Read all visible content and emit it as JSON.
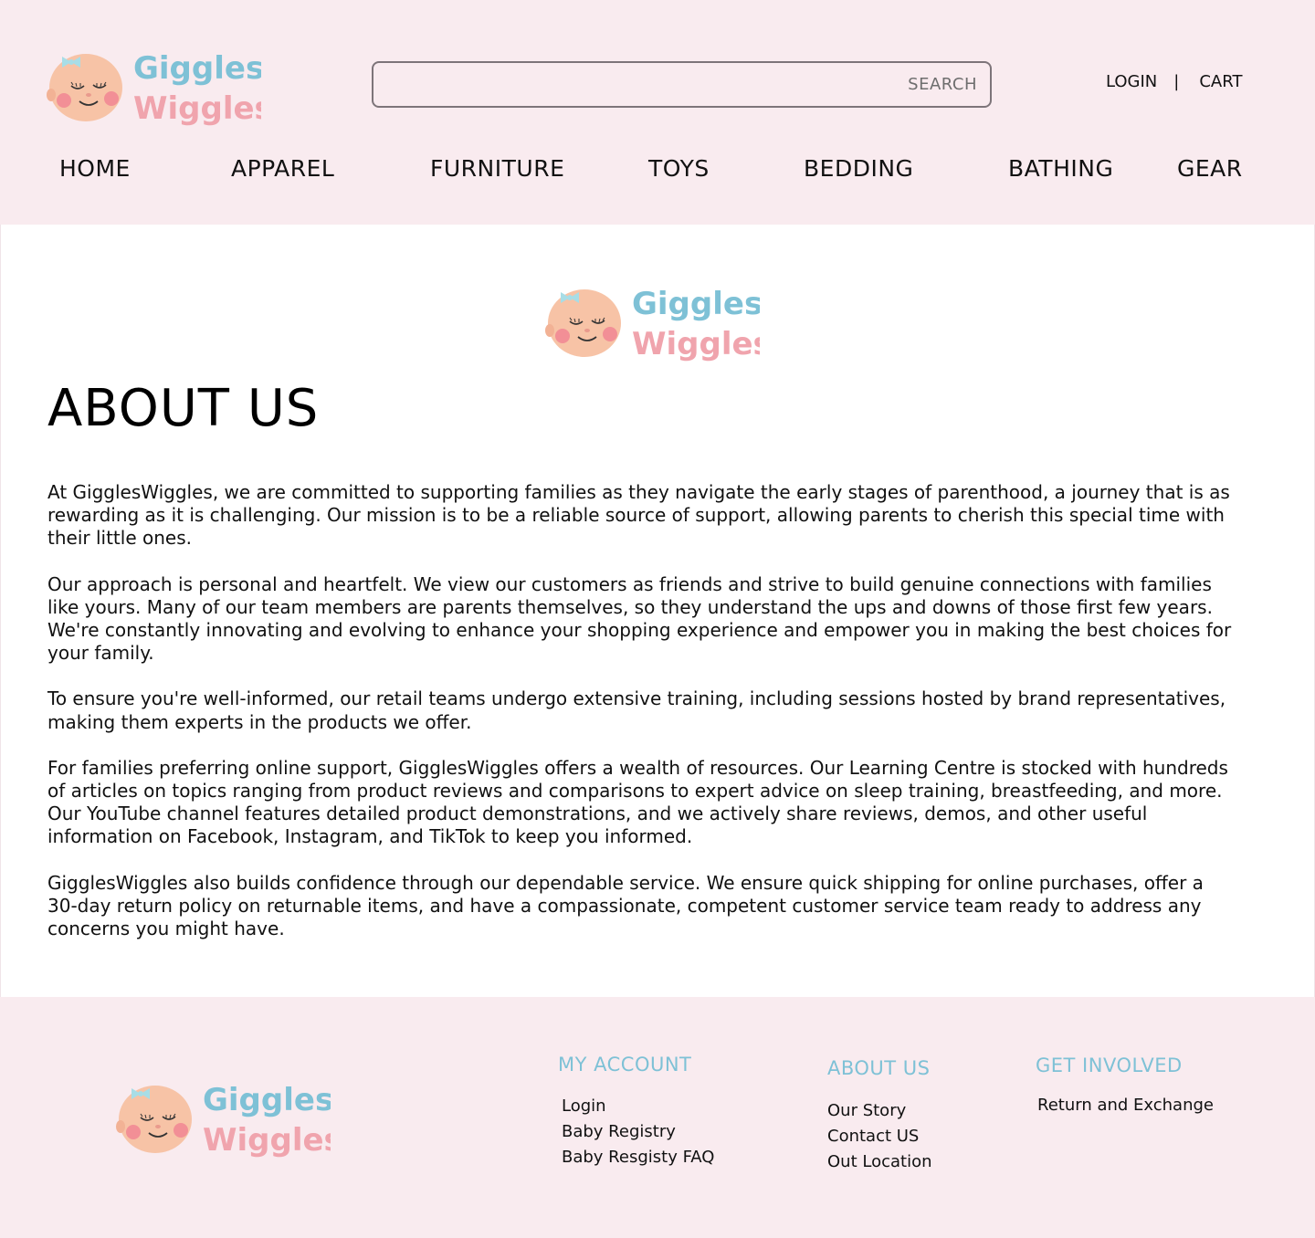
{
  "brand": {
    "logo_line1": "Giggles",
    "logo_line2": "Wiggles",
    "colors": {
      "header_bg": "#f9ebef",
      "logo_blue": "#7ec1d6",
      "logo_pink": "#f0a4ad",
      "face": "#f7c3a6",
      "cheek": "#f28f96",
      "bow": "#a8dde6"
    }
  },
  "search": {
    "placeholder": "",
    "button_label": "SEARCH"
  },
  "account": {
    "login": "LOGIN",
    "separator": "|",
    "cart": "CART"
  },
  "nav": {
    "items": [
      {
        "label": "HOME"
      },
      {
        "label": "APPAREL"
      },
      {
        "label": "FURNITURE"
      },
      {
        "label": "TOYS"
      },
      {
        "label": "BEDDING"
      },
      {
        "label": "BATHING"
      },
      {
        "label": "GEAR"
      }
    ]
  },
  "main": {
    "title": "ABOUT US",
    "paragraphs": [
      "At GigglesWiggles, we are committed to supporting families as they navigate the early stages of parenthood, a journey that is as rewarding as it is challenging. Our mission is to be a reliable source of support, allowing parents to cherish this special time with their little ones.",
      "Our approach is personal and heartfelt. We view our customers as friends and strive to build genuine connections with families like yours. Many of our team members are parents themselves, so they understand the ups and downs of those first few years. We're constantly innovating and evolving to enhance your shopping experience and empower you in making the best choices for your family.",
      "To ensure you're well-informed, our retail teams undergo extensive training, including sessions hosted by brand representatives, making them experts in the products we offer.",
      "For families preferring online support, GigglesWiggles offers a wealth of resources. Our Learning Centre is stocked with hundreds of articles on topics ranging from product reviews and comparisons to expert advice on sleep training, breastfeeding, and more. Our YouTube channel features detailed product demonstrations, and we actively share reviews, demos, and other useful information on Facebook, Instagram, and TikTok to keep you informed.",
      "GigglesWiggles also builds confidence through our dependable service. We ensure quick shipping for online purchases, offer a 30-day return policy on returnable items, and have a compassionate, competent customer service team ready to address any concerns you might have."
    ]
  },
  "footer": {
    "my_account": {
      "title": "MY ACCOUNT",
      "links": [
        "Login",
        "Baby Registry",
        "Baby Resgisty FAQ"
      ]
    },
    "about_us": {
      "title": "ABOUT US",
      "links": [
        "Our Story",
        "Contact US",
        "Out Location"
      ]
    },
    "get_involved": {
      "title": "GET INVOLVED",
      "links": [
        "Return and Exchange"
      ]
    }
  }
}
